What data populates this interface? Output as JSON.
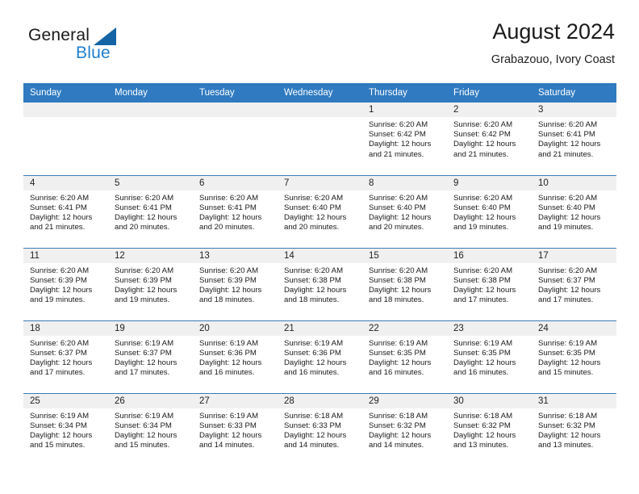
{
  "brand": {
    "name_part1": "General",
    "name_part2": "Blue",
    "logo_icon": "triangle-flag-icon",
    "accent_color": "#1f7fd0",
    "triangle_color": "#1464a5"
  },
  "header": {
    "title": "August 2024",
    "subtitle": "Grabazouo, Ivory Coast"
  },
  "calendar": {
    "header_bg": "#2f7ac0",
    "daynum_bg": "#f0f0f0",
    "weekdays": [
      "Sunday",
      "Monday",
      "Tuesday",
      "Wednesday",
      "Thursday",
      "Friday",
      "Saturday"
    ],
    "weeks": [
      [
        {
          "day": "",
          "lines": []
        },
        {
          "day": "",
          "lines": []
        },
        {
          "day": "",
          "lines": []
        },
        {
          "day": "",
          "lines": []
        },
        {
          "day": "1",
          "lines": [
            "Sunrise: 6:20 AM",
            "Sunset: 6:42 PM",
            "Daylight: 12 hours",
            "and 21 minutes."
          ]
        },
        {
          "day": "2",
          "lines": [
            "Sunrise: 6:20 AM",
            "Sunset: 6:42 PM",
            "Daylight: 12 hours",
            "and 21 minutes."
          ]
        },
        {
          "day": "3",
          "lines": [
            "Sunrise: 6:20 AM",
            "Sunset: 6:41 PM",
            "Daylight: 12 hours",
            "and 21 minutes."
          ]
        }
      ],
      [
        {
          "day": "4",
          "lines": [
            "Sunrise: 6:20 AM",
            "Sunset: 6:41 PM",
            "Daylight: 12 hours",
            "and 21 minutes."
          ]
        },
        {
          "day": "5",
          "lines": [
            "Sunrise: 6:20 AM",
            "Sunset: 6:41 PM",
            "Daylight: 12 hours",
            "and 20 minutes."
          ]
        },
        {
          "day": "6",
          "lines": [
            "Sunrise: 6:20 AM",
            "Sunset: 6:41 PM",
            "Daylight: 12 hours",
            "and 20 minutes."
          ]
        },
        {
          "day": "7",
          "lines": [
            "Sunrise: 6:20 AM",
            "Sunset: 6:40 PM",
            "Daylight: 12 hours",
            "and 20 minutes."
          ]
        },
        {
          "day": "8",
          "lines": [
            "Sunrise: 6:20 AM",
            "Sunset: 6:40 PM",
            "Daylight: 12 hours",
            "and 20 minutes."
          ]
        },
        {
          "day": "9",
          "lines": [
            "Sunrise: 6:20 AM",
            "Sunset: 6:40 PM",
            "Daylight: 12 hours",
            "and 19 minutes."
          ]
        },
        {
          "day": "10",
          "lines": [
            "Sunrise: 6:20 AM",
            "Sunset: 6:40 PM",
            "Daylight: 12 hours",
            "and 19 minutes."
          ]
        }
      ],
      [
        {
          "day": "11",
          "lines": [
            "Sunrise: 6:20 AM",
            "Sunset: 6:39 PM",
            "Daylight: 12 hours",
            "and 19 minutes."
          ]
        },
        {
          "day": "12",
          "lines": [
            "Sunrise: 6:20 AM",
            "Sunset: 6:39 PM",
            "Daylight: 12 hours",
            "and 19 minutes."
          ]
        },
        {
          "day": "13",
          "lines": [
            "Sunrise: 6:20 AM",
            "Sunset: 6:39 PM",
            "Daylight: 12 hours",
            "and 18 minutes."
          ]
        },
        {
          "day": "14",
          "lines": [
            "Sunrise: 6:20 AM",
            "Sunset: 6:38 PM",
            "Daylight: 12 hours",
            "and 18 minutes."
          ]
        },
        {
          "day": "15",
          "lines": [
            "Sunrise: 6:20 AM",
            "Sunset: 6:38 PM",
            "Daylight: 12 hours",
            "and 18 minutes."
          ]
        },
        {
          "day": "16",
          "lines": [
            "Sunrise: 6:20 AM",
            "Sunset: 6:38 PM",
            "Daylight: 12 hours",
            "and 17 minutes."
          ]
        },
        {
          "day": "17",
          "lines": [
            "Sunrise: 6:20 AM",
            "Sunset: 6:37 PM",
            "Daylight: 12 hours",
            "and 17 minutes."
          ]
        }
      ],
      [
        {
          "day": "18",
          "lines": [
            "Sunrise: 6:20 AM",
            "Sunset: 6:37 PM",
            "Daylight: 12 hours",
            "and 17 minutes."
          ]
        },
        {
          "day": "19",
          "lines": [
            "Sunrise: 6:19 AM",
            "Sunset: 6:37 PM",
            "Daylight: 12 hours",
            "and 17 minutes."
          ]
        },
        {
          "day": "20",
          "lines": [
            "Sunrise: 6:19 AM",
            "Sunset: 6:36 PM",
            "Daylight: 12 hours",
            "and 16 minutes."
          ]
        },
        {
          "day": "21",
          "lines": [
            "Sunrise: 6:19 AM",
            "Sunset: 6:36 PM",
            "Daylight: 12 hours",
            "and 16 minutes."
          ]
        },
        {
          "day": "22",
          "lines": [
            "Sunrise: 6:19 AM",
            "Sunset: 6:35 PM",
            "Daylight: 12 hours",
            "and 16 minutes."
          ]
        },
        {
          "day": "23",
          "lines": [
            "Sunrise: 6:19 AM",
            "Sunset: 6:35 PM",
            "Daylight: 12 hours",
            "and 16 minutes."
          ]
        },
        {
          "day": "24",
          "lines": [
            "Sunrise: 6:19 AM",
            "Sunset: 6:35 PM",
            "Daylight: 12 hours",
            "and 15 minutes."
          ]
        }
      ],
      [
        {
          "day": "25",
          "lines": [
            "Sunrise: 6:19 AM",
            "Sunset: 6:34 PM",
            "Daylight: 12 hours",
            "and 15 minutes."
          ]
        },
        {
          "day": "26",
          "lines": [
            "Sunrise: 6:19 AM",
            "Sunset: 6:34 PM",
            "Daylight: 12 hours",
            "and 15 minutes."
          ]
        },
        {
          "day": "27",
          "lines": [
            "Sunrise: 6:19 AM",
            "Sunset: 6:33 PM",
            "Daylight: 12 hours",
            "and 14 minutes."
          ]
        },
        {
          "day": "28",
          "lines": [
            "Sunrise: 6:18 AM",
            "Sunset: 6:33 PM",
            "Daylight: 12 hours",
            "and 14 minutes."
          ]
        },
        {
          "day": "29",
          "lines": [
            "Sunrise: 6:18 AM",
            "Sunset: 6:32 PM",
            "Daylight: 12 hours",
            "and 14 minutes."
          ]
        },
        {
          "day": "30",
          "lines": [
            "Sunrise: 6:18 AM",
            "Sunset: 6:32 PM",
            "Daylight: 12 hours",
            "and 13 minutes."
          ]
        },
        {
          "day": "31",
          "lines": [
            "Sunrise: 6:18 AM",
            "Sunset: 6:32 PM",
            "Daylight: 12 hours",
            "and 13 minutes."
          ]
        }
      ]
    ]
  }
}
